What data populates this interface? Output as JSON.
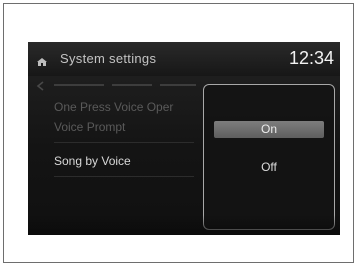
{
  "header": {
    "title": "System settings",
    "clock": "12:34"
  },
  "settings_list": [
    {
      "label": "One Press Voice Oper",
      "state": "dim"
    },
    {
      "label": "Voice Prompt",
      "state": "dim"
    },
    {
      "label": "Song by Voice",
      "state": "active"
    }
  ],
  "popup": {
    "options": [
      {
        "label": "On",
        "selected": true
      },
      {
        "label": "Off",
        "selected": false
      }
    ]
  },
  "icons": {
    "home": "home-icon",
    "back": "back-arrow-icon"
  },
  "colors": {
    "screen_bg": "#141414",
    "selected_option": "#6e6e6e",
    "popup_border": "#a8a8a8"
  }
}
